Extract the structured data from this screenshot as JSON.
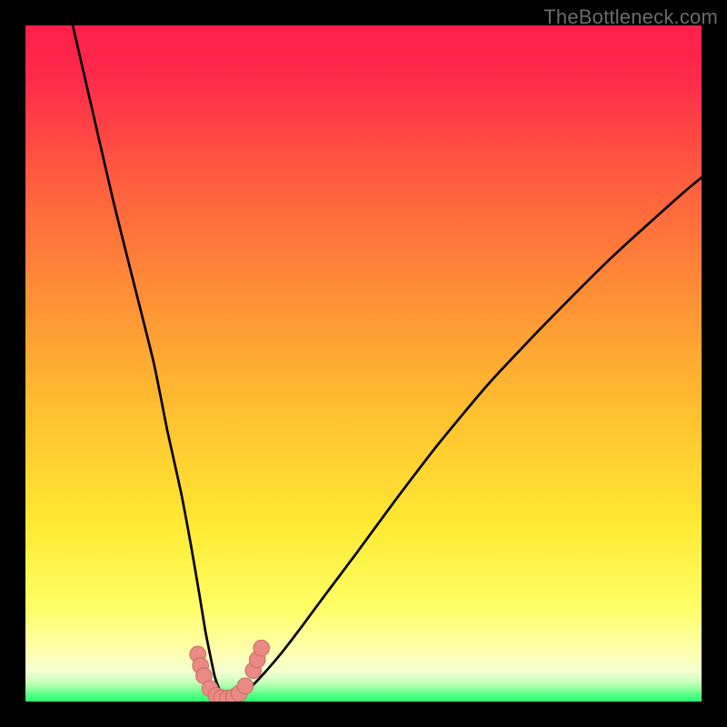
{
  "watermark": "TheBottleneck.com",
  "colors": {
    "gradient_top": "#ff1f4a",
    "gradient_mid1": "#ff7a3a",
    "gradient_mid2": "#ffd232",
    "gradient_low": "#ffff9a",
    "gradient_floor": "#35ff7a",
    "curve": "#000000",
    "marker_fill": "#e98a84",
    "marker_stroke": "#c96b63",
    "frame_bg": "#000000"
  },
  "chart_data": {
    "type": "line",
    "title": "",
    "xlabel": "",
    "ylabel": "",
    "xlim": [
      0,
      100
    ],
    "ylim": [
      0,
      100
    ],
    "grid": false,
    "legend": false,
    "annotations": [],
    "series": [
      {
        "name": "bottleneck-curve",
        "x": [
          7,
          10,
          13,
          16,
          19,
          21,
          23,
          24.5,
          25.7,
          26.6,
          27.4,
          28,
          28.6,
          29.2,
          30,
          31,
          32.2,
          33.6,
          35.4,
          37.8,
          40.8,
          44.5,
          49,
          54.5,
          61,
          68.5,
          77,
          86.5,
          97,
          100
        ],
        "y": [
          100,
          87,
          74,
          62,
          50,
          40,
          31,
          23,
          16,
          10.5,
          6.5,
          3.7,
          2.0,
          1.1,
          0.8,
          0.8,
          1.3,
          2.4,
          4.3,
          7.1,
          11,
          16,
          22,
          29.5,
          38,
          47,
          56,
          65.5,
          75,
          77.5
        ]
      }
    ],
    "markers": [
      {
        "x": 25.5,
        "y": 7.0
      },
      {
        "x": 25.9,
        "y": 5.3
      },
      {
        "x": 26.4,
        "y": 3.8
      },
      {
        "x": 27.3,
        "y": 1.9
      },
      {
        "x": 28.2,
        "y": 0.9
      },
      {
        "x": 29.0,
        "y": 0.55
      },
      {
        "x": 29.9,
        "y": 0.5
      },
      {
        "x": 30.8,
        "y": 0.7
      },
      {
        "x": 31.6,
        "y": 1.2
      },
      {
        "x": 32.5,
        "y": 2.3
      },
      {
        "x": 33.7,
        "y": 4.6
      },
      {
        "x": 34.3,
        "y": 6.2
      },
      {
        "x": 34.9,
        "y": 7.9
      }
    ]
  }
}
